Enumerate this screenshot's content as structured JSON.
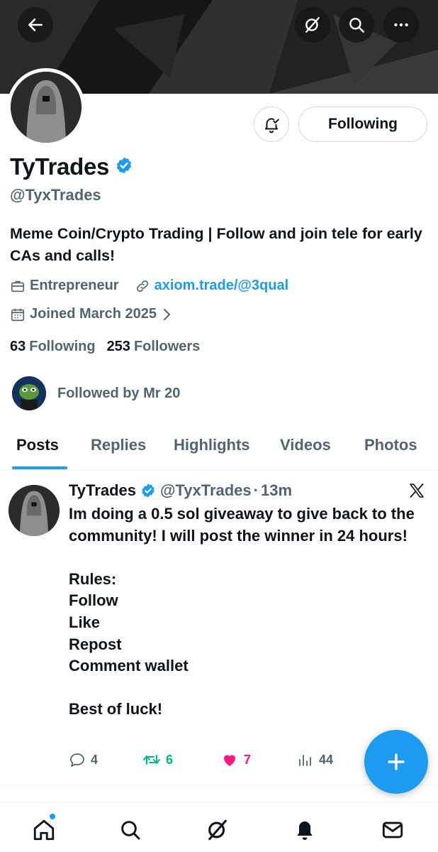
{
  "header": {
    "back_icon": "arrow-left-icon",
    "grok_icon": "grok-icon",
    "search_icon": "search-icon",
    "more_icon": "more-horizontal-icon"
  },
  "profile": {
    "display_name": "TyTrades",
    "handle": "@TyxTrades",
    "bio": "Meme Coin/Crypto Trading | Follow and join tele for early CAs and calls!",
    "category": "Entrepreneur",
    "website": "axiom.trade/@3qual",
    "joined": "Joined March 2025",
    "following_count": "63",
    "following_label": "Following",
    "followers_count": "253",
    "followers_label": "Followers",
    "followed_by": "Followed by Mr 20",
    "follow_button_label": "Following"
  },
  "tabs": [
    "Posts",
    "Replies",
    "Highlights",
    "Videos",
    "Photos"
  ],
  "post": {
    "author_name": "TyTrades",
    "author_handle": "@TyxTrades",
    "separator": "·",
    "time": "13m",
    "body": "Im doing a 0.5 sol giveaway to give back to the community! I will post the winner in 24 hours!\n\nRules:\nFollow\nLike\nRepost\nComment wallet\n\nBest of luck!",
    "replies": "4",
    "reposts": "6",
    "likes": "7",
    "views": "44"
  },
  "colors": {
    "accent": "#1d9bf0",
    "secondary_text": "#536471",
    "repost": "#00ba7c",
    "like": "#f91880"
  }
}
